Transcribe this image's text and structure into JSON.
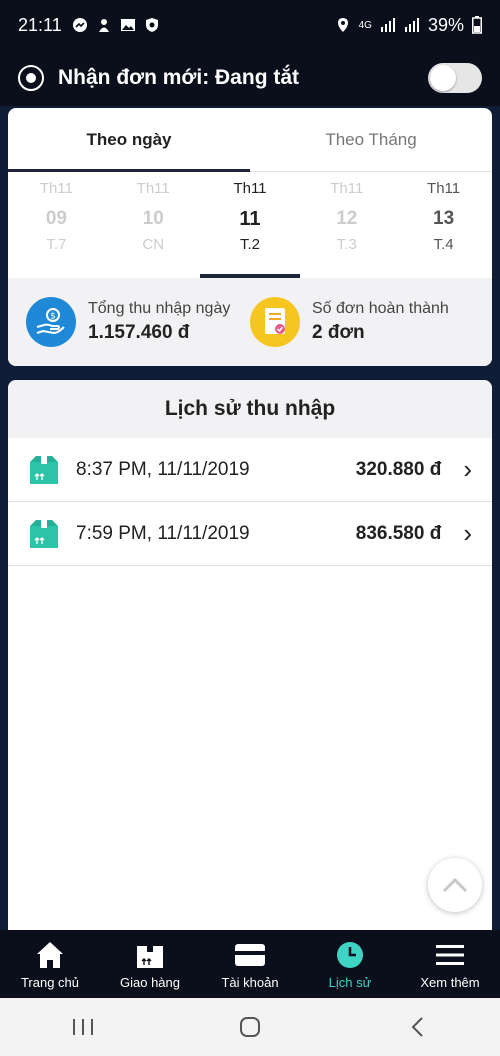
{
  "status_bar": {
    "time": "21:11",
    "network": "4G",
    "battery": "39%"
  },
  "header": {
    "title": "Nhận đơn mới: Đang tắt",
    "toggle_state": "off"
  },
  "tabs": [
    {
      "label": "Theo ngày",
      "active": true
    },
    {
      "label": "Theo Tháng",
      "active": false
    }
  ],
  "days": [
    {
      "month": "Th11",
      "day": "09",
      "weekday": "T.7"
    },
    {
      "month": "Th11",
      "day": "10",
      "weekday": "CN"
    },
    {
      "month": "Th11",
      "day": "11",
      "weekday": "T.2",
      "selected": true
    },
    {
      "month": "Th11",
      "day": "12",
      "weekday": "T.3"
    },
    {
      "month": "Th11",
      "day": "13",
      "weekday": "T.4"
    }
  ],
  "summary": {
    "income_label": "Tổng thu nhập ngày",
    "income_value": "1.157.460 đ",
    "orders_label": "Số đơn hoàn thành",
    "orders_value": "2 đơn"
  },
  "history": {
    "title": "Lịch sử thu nhập",
    "rows": [
      {
        "time": "8:37 PM, 11/11/2019",
        "amount": "320.880 đ"
      },
      {
        "time": "7:59 PM, 11/11/2019",
        "amount": "836.580 đ"
      }
    ]
  },
  "nav": [
    {
      "label": "Trang chủ",
      "icon": "home-icon"
    },
    {
      "label": "Giao hàng",
      "icon": "package-icon"
    },
    {
      "label": "Tài khoản",
      "icon": "card-icon"
    },
    {
      "label": "Lịch sử",
      "icon": "clock-icon",
      "active": true
    },
    {
      "label": "Xem thêm",
      "icon": "menu-icon"
    }
  ],
  "colors": {
    "accent": "#3fd3c3",
    "dark_bg": "#0b0f1c",
    "income_icon": "#1f89d8",
    "orders_icon": "#f5c620"
  }
}
